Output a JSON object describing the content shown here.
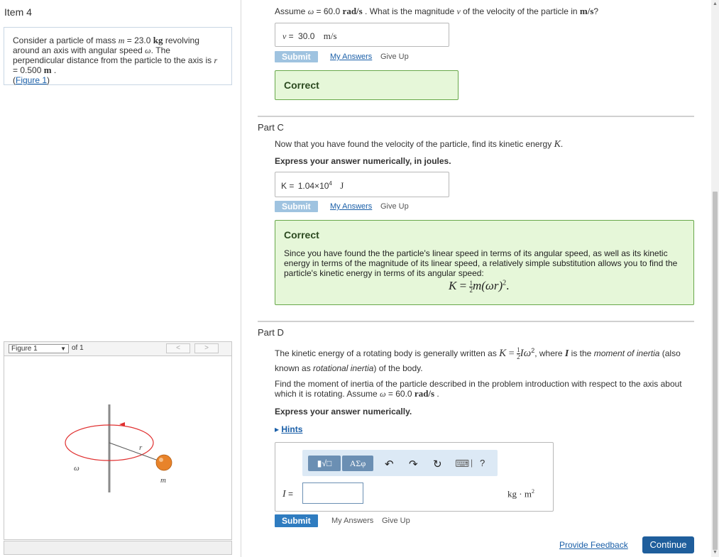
{
  "item_title": "Item 4",
  "intro": {
    "prefix": "Consider a particle of mass ",
    "m_sym": "m",
    "eq1": " = 23.0 ",
    "unit_kg": "kg",
    "mid1": " revolving around an axis with angular speed ",
    "omega_sym": "ω",
    "mid2": ". The perpendicular distance from the particle to the axis is ",
    "r_sym": "r",
    "eq2": " = 0.500 ",
    "unit_m": "m",
    "end": " .",
    "figure_link": "Figure 1",
    "paren_open": "(",
    "paren_close": ")"
  },
  "figure_nav": {
    "selected": "Figure 1",
    "of_label": "of 1",
    "prev": "<",
    "next": ">"
  },
  "figure": {
    "omega_label": "ω",
    "r_label": "r",
    "m_label": "m",
    "colors": {
      "orbit": "#e03030",
      "ball": "#e8832a",
      "axis": "#888888"
    }
  },
  "part_b": {
    "q_prefix": "Assume ",
    "omega": "ω",
    "q_eq": " = 60.0 ",
    "q_unit": "rad/s",
    "q_mid": " . What is the magnitude ",
    "v": "v",
    "q_mid2": " of the velocity of the particle in ",
    "q_unit2": "m/s",
    "q_end": "?",
    "answer_var": "v",
    "answer_eq": " = ",
    "answer_value": "30.0",
    "answer_unit": "m/s",
    "submit": "Submit",
    "my_answers": "My Answers",
    "give_up": "Give Up",
    "correct": "Correct"
  },
  "part_c": {
    "title": "Part C",
    "question_pre": "Now that you have found the velocity of the particle, find its kinetic energy ",
    "question_K": "K",
    "question_end": ".",
    "instruction": "Express your answer numerically, in joules.",
    "answer_var": "K",
    "answer_eq": " = ",
    "answer_mantissa": "1.04×10",
    "answer_exp": "4",
    "answer_unit": "J",
    "submit": "Submit",
    "my_answers": "My Answers",
    "give_up": "Give Up",
    "correct": "Correct",
    "feedback": "Since you have found the the particle's linear speed in terms of its angular speed, as well as its kinetic energy in terms of the magnitude of its linear speed, a relatively simple substitution allows you to find the particle's kinetic energy in terms of its angular speed:",
    "formula_lhs": "K",
    "formula_eq": " = ",
    "formula_num": "1",
    "formula_den": "2",
    "formula_body": "m(ωr)",
    "formula_exp": "2",
    "formula_end": "."
  },
  "part_d": {
    "title": "Part D",
    "text1_pre": "The kinetic energy of a rotating body is generally written as ",
    "text1_K": "K",
    "text1_eq": " = ",
    "text1_num": "1",
    "text1_den": "2",
    "text1_I": "I",
    "text1_omega": "ω",
    "text1_exp": "2",
    "text1_mid": ", where ",
    "text1_I2": "I",
    "text1_is": " is the ",
    "text1_moi": "moment of inertia",
    "text1_also": " (also known as ",
    "text1_ri": "rotational inertia",
    "text1_end": ") of the body.",
    "text2_pre": "Find the moment of inertia of the particle described in the problem introduction with respect to the axis about which it is rotating. Assume ",
    "text2_omega": "ω",
    "text2_eq": " = 60.0 ",
    "text2_unit": "rad/s",
    "text2_end": " .",
    "instruction": "Express your answer numerically.",
    "hints_arrow": "▸",
    "hints": "Hints",
    "tb_templates": "▮√□",
    "tb_symbols": "ΑΣφ",
    "tb_undo": "↶",
    "tb_redo": "↷",
    "tb_reset": "↻",
    "tb_keyboard": "⌨",
    "tb_sep": "|",
    "tb_help": "?",
    "input_label": "I",
    "input_eq": " =",
    "input_value": "",
    "unit_kg": "kg",
    "unit_dot": " · ",
    "unit_m": "m",
    "unit_exp": "2",
    "submit": "Submit",
    "my_answers": "My Answers",
    "give_up": "Give Up"
  },
  "footer": {
    "provide_feedback": "Provide Feedback",
    "continue": "Continue"
  }
}
